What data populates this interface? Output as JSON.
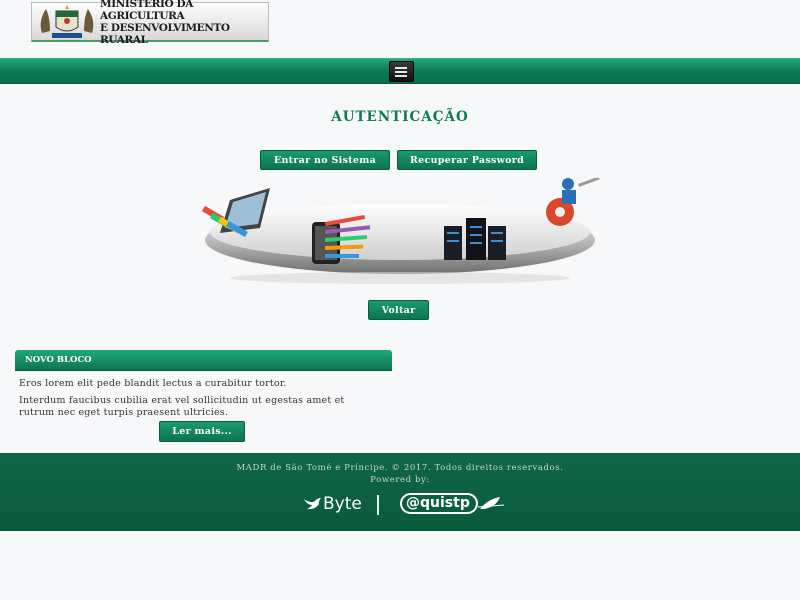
{
  "header": {
    "logo_line1": "MINISTÉRIO DA AGRICULTURA",
    "logo_line2": "E DESENVOLVIMENTO RUARAL",
    "crest_motto": "TRABALHO"
  },
  "nav": {
    "menu_icon": "hamburger-icon"
  },
  "auth": {
    "title": "AUTENTICAÇÃO",
    "login_button": "Entrar no Sistema",
    "recover_button": "Recuperar Password",
    "back_button": "Voltar"
  },
  "block": {
    "title": "NOVO BLOCO",
    "paragraph1": "Eros lorem elit pede blandit lectus a curabitur tortor.",
    "paragraph2_line1": "Interdum faucibus cubilia erat vel sollicitudin ut egestas amet et",
    "paragraph2_line2": "rutrum nec eget turpis praesent ultricies.",
    "read_more": "Ler mais..."
  },
  "footer": {
    "copyright": "MADR de São Tomé e Príncipe. © 2017. Todos direitos reservados.",
    "powered_by": "Powered by:",
    "partner1": "Byte",
    "partner2": "@quistp"
  },
  "colors": {
    "brand_green": "#0f7a55",
    "footer_green": "#0b5a3d",
    "background": "#f7f8fa"
  }
}
